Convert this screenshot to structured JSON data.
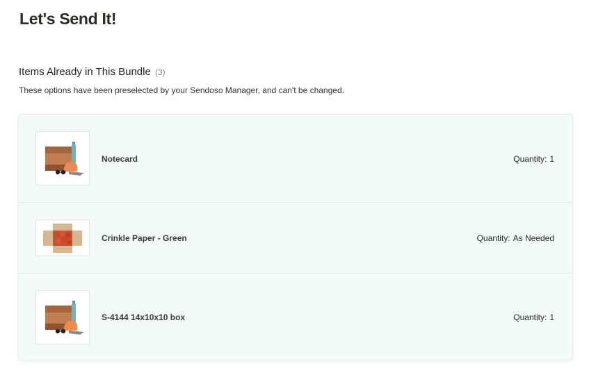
{
  "page": {
    "title": "Let's Send It!"
  },
  "bundle": {
    "heading": "Items Already in This Bundle",
    "count": "(3)",
    "subtitle": "These options have been preselected by your Sendoso Manager, and can't be changed.",
    "items": [
      {
        "name": "Notecard",
        "quantity_label": "Quantity:",
        "quantity_value": "1",
        "image_icon": "gift-box-bundle-icon"
      },
      {
        "name": "Crinkle Paper - Green",
        "quantity_label": "Quantity:",
        "quantity_value": "As Needed",
        "image_icon": "crinkle-paper-box-icon"
      },
      {
        "name": "S-4144 14x10x10 box",
        "quantity_label": "Quantity:",
        "quantity_value": "1",
        "image_icon": "gift-box-bundle-icon"
      }
    ]
  },
  "colors": {
    "panel_background": "#f3fafa",
    "title_text": "#2e2a24",
    "box_brown": "#b9774a",
    "cap_orange": "#ef8a4f",
    "bottle_teal": "#6fb3bf",
    "crinkle_red": "#d8442a"
  }
}
